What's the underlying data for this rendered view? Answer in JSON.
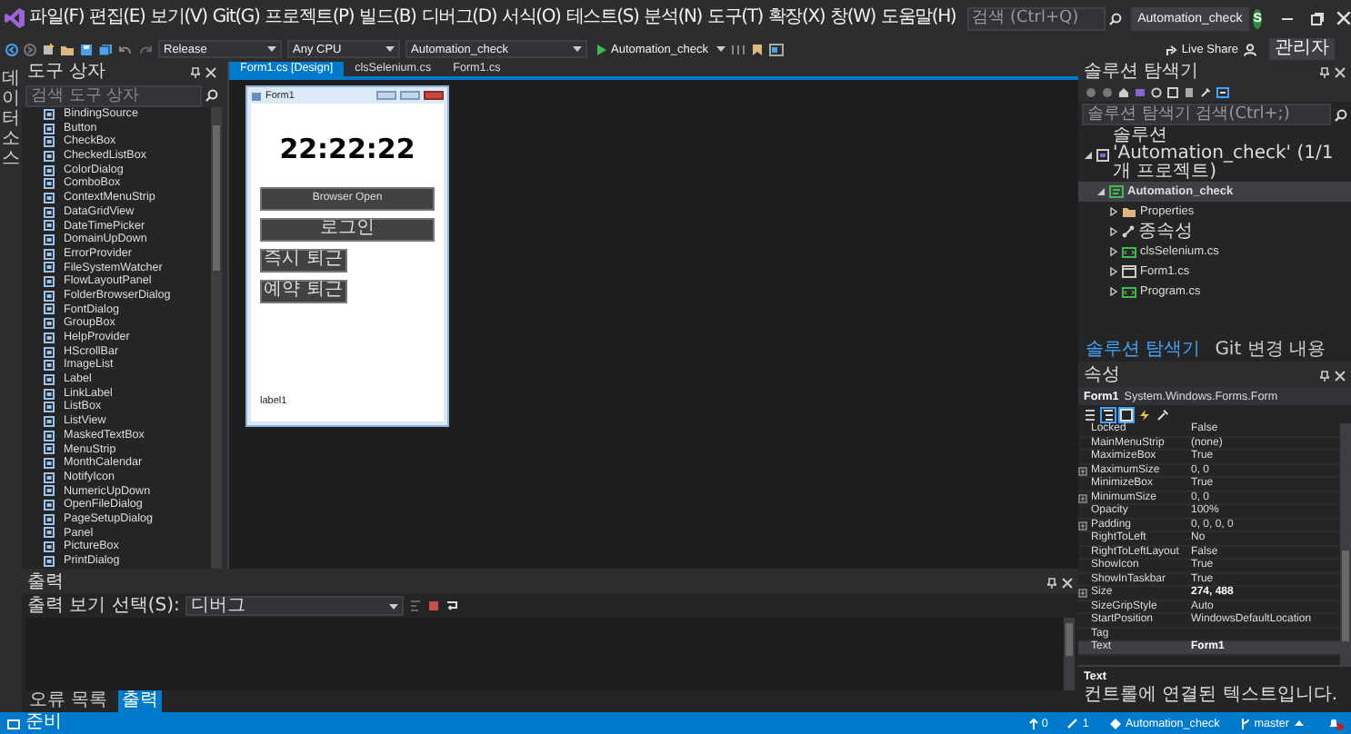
{
  "menu_bar": {
    "items": [
      "파일(F)",
      "편집(E)",
      "보기(V)",
      "Git(G)",
      "프로젝트(P)",
      "빌드(B)",
      "디버그(D)",
      "서식(O)",
      "테스트(S)",
      "분석(N)",
      "도구(T)",
      "확장(X)",
      "창(W)",
      "도움말(H)"
    ],
    "search": {
      "placeholder": "검색 (Ctrl+Q)"
    },
    "solution_title": "Automation_check",
    "avatar": "S"
  },
  "toolbar": {
    "configuration": "Release",
    "platform": "Any CPU",
    "startup_project": "Automation_check",
    "run_button": "Automation_check",
    "live_share": "Live Share",
    "admin_badge": "관리자"
  },
  "left_side_tab": "데이터 소스",
  "toolbox": {
    "title": "도구 상자",
    "search": {
      "placeholder": "검색 도구 상자"
    },
    "items": [
      "BindingSource",
      "Button",
      "CheckBox",
      "CheckedListBox",
      "ColorDialog",
      "ComboBox",
      "ContextMenuStrip",
      "DataGridView",
      "DateTimePicker",
      "DomainUpDown",
      "ErrorProvider",
      "FileSystemWatcher",
      "FlowLayoutPanel",
      "FolderBrowserDialog",
      "FontDialog",
      "GroupBox",
      "HelpProvider",
      "HScrollBar",
      "ImageList",
      "Label",
      "LinkLabel",
      "ListBox",
      "ListView",
      "MaskedTextBox",
      "MenuStrip",
      "MonthCalendar",
      "NotifyIcon",
      "NumericUpDown",
      "OpenFileDialog",
      "PageSetupDialog",
      "Panel",
      "PictureBox",
      "PrintDialog"
    ]
  },
  "editor_tabs": [
    {
      "label": "Form1.cs [Design]",
      "selected": true
    },
    {
      "label": "clsSelenium.cs",
      "selected": false
    },
    {
      "label": "Form1.cs",
      "selected": false
    }
  ],
  "form_designer": {
    "title": "Form1",
    "clock": "22:22:22",
    "buttons": [
      {
        "label": "Browser Open",
        "kind": "wide"
      },
      {
        "label": "로그인",
        "kind": "wide"
      },
      {
        "label": "즉시 퇴근",
        "kind": "half"
      },
      {
        "label": "예약 퇴근",
        "kind": "half"
      }
    ],
    "status_label": "label1"
  },
  "solution_explorer": {
    "title": "솔루션 탐색기",
    "search": {
      "placeholder": "솔루션 탐색기 검색(Ctrl+;)"
    },
    "tree": [
      {
        "label": "솔루션 'Automation_check' (1/1개 프로젝트)",
        "kind": "solution",
        "selected": false,
        "expanded": true,
        "children": [
          {
            "label": "Automation_check",
            "kind": "project",
            "selected": true,
            "expanded": true,
            "children": [
              {
                "label": "Properties",
                "kind": "folder",
                "selected": false,
                "expanded": false
              },
              {
                "label": "종속성",
                "kind": "references",
                "selected": false,
                "expanded": false
              },
              {
                "label": "clsSelenium.cs",
                "kind": "file",
                "selected": false,
                "expanded": false
              },
              {
                "label": "Form1.cs",
                "kind": "form",
                "selected": false,
                "expanded": false
              },
              {
                "label": "Program.cs",
                "kind": "file",
                "selected": false,
                "expanded": false
              }
            ]
          }
        ]
      }
    ],
    "tabs": [
      {
        "label": "솔루션 탐색기",
        "selected": true
      },
      {
        "label": "Git 변경 내용",
        "selected": false
      }
    ]
  },
  "properties": {
    "title": "속성",
    "object": "Form1",
    "object_type": "System.Windows.Forms.Form",
    "rows": [
      {
        "name": "Locked",
        "value": "False",
        "expandable": false,
        "modified": false,
        "selected": false
      },
      {
        "name": "MainMenuStrip",
        "value": "(none)",
        "expandable": false,
        "modified": false,
        "selected": false
      },
      {
        "name": "MaximizeBox",
        "value": "True",
        "expandable": false,
        "modified": false,
        "selected": false
      },
      {
        "name": "MaximumSize",
        "value": "0, 0",
        "expandable": true,
        "modified": false,
        "selected": false
      },
      {
        "name": "MinimizeBox",
        "value": "True",
        "expandable": false,
        "modified": false,
        "selected": false
      },
      {
        "name": "MinimumSize",
        "value": "0, 0",
        "expandable": true,
        "modified": false,
        "selected": false
      },
      {
        "name": "Opacity",
        "value": "100%",
        "expandable": false,
        "modified": false,
        "selected": false
      },
      {
        "name": "Padding",
        "value": "0, 0, 0, 0",
        "expandable": true,
        "modified": false,
        "selected": false
      },
      {
        "name": "RightToLeft",
        "value": "No",
        "expandable": false,
        "modified": false,
        "selected": false
      },
      {
        "name": "RightToLeftLayout",
        "value": "False",
        "expandable": false,
        "modified": false,
        "selected": false
      },
      {
        "name": "ShowIcon",
        "value": "True",
        "expandable": false,
        "modified": false,
        "selected": false
      },
      {
        "name": "ShowInTaskbar",
        "value": "True",
        "expandable": false,
        "modified": false,
        "selected": false
      },
      {
        "name": "Size",
        "value": "274, 488",
        "expandable": true,
        "modified": true,
        "selected": false
      },
      {
        "name": "SizeGripStyle",
        "value": "Auto",
        "expandable": false,
        "modified": false,
        "selected": false
      },
      {
        "name": "StartPosition",
        "value": "WindowsDefaultLocation",
        "expandable": false,
        "modified": false,
        "selected": false
      },
      {
        "name": "Tag",
        "expandable": false,
        "modified": false,
        "selected": false
      },
      {
        "name": "Text",
        "value": "Form1",
        "expandable": false,
        "modified": true,
        "selected": true
      }
    ],
    "description": {
      "title": "Text",
      "text": "컨트롤에 연결된 텍스트입니다."
    }
  },
  "output": {
    "title": "출력",
    "source_label": "출력 보기 선택(S):",
    "source": "디버그",
    "tabs": [
      {
        "label": "오류 목록",
        "selected": false
      },
      {
        "label": "출력",
        "selected": true
      }
    ]
  },
  "status_bar": {
    "state": "준비",
    "pushes": "0",
    "changes": "1",
    "repository": "Automation_check",
    "branch": "master"
  }
}
